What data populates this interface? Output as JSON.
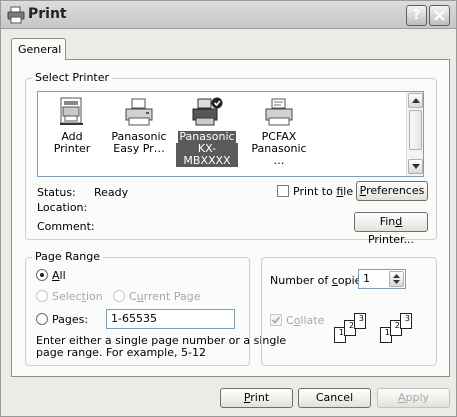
{
  "window": {
    "title": "Print"
  },
  "tabs": {
    "general": "General"
  },
  "select_printer": {
    "legend": "Select Printer",
    "printers": [
      {
        "line1": "Add Printer",
        "line2": "",
        "icon": "add-printer-icon",
        "selected": false
      },
      {
        "line1": "Panasonic",
        "line2": "Easy Pr…",
        "icon": "printer-icon",
        "selected": false
      },
      {
        "line1": "Panasonic",
        "line2": "KX-MBXXXX",
        "icon": "default-printer-icon",
        "selected": true
      },
      {
        "line1": "PCFAX",
        "line2": "Panasonic …",
        "icon": "fax-printer-icon",
        "selected": false
      }
    ],
    "status_label": "Status:",
    "status_value": "Ready",
    "location_label": "Location:",
    "location_value": "",
    "comment_label": "Comment:",
    "comment_value": "",
    "print_to_file_label_pre": "Print to ",
    "print_to_file_label_u": "f",
    "print_to_file_label_post": "ile",
    "print_to_file_checked": false,
    "preferences_label_u": "P",
    "preferences_label_post": "references",
    "find_printer_label_pre": "Fin",
    "find_printer_label_u": "d",
    "find_printer_label_post": " Printer..."
  },
  "page_range": {
    "legend": "Page Range",
    "all_u": "A",
    "all_post": "ll",
    "selection_pre": "Selec",
    "selection_u": "t",
    "selection_post": "ion",
    "current_page_pre": "C",
    "current_page_u": "u",
    "current_page_post": "rrent Page",
    "pages_pre": "Pa",
    "pages_u": "g",
    "pages_post": "es:",
    "pages_value": "1-65535",
    "hint_line1": "Enter either a single page number or a single",
    "hint_line2": "page range.  For example, 5-12",
    "selected_option": "all"
  },
  "copies": {
    "label_pre": "Number of ",
    "label_u": "c",
    "label_post": "opies:",
    "value": "1",
    "collate_pre": "C",
    "collate_u": "o",
    "collate_post": "llate",
    "collate_checked": true,
    "collate_enabled": false,
    "collated_pages": [
      "1",
      "2",
      "3"
    ],
    "uncollated_pages": [
      "1",
      "2",
      "3"
    ]
  },
  "buttons": {
    "print_u": "P",
    "print_post": "rint",
    "cancel": "Cancel",
    "apply_u": "A",
    "apply_post": "pply",
    "apply_enabled": false
  }
}
